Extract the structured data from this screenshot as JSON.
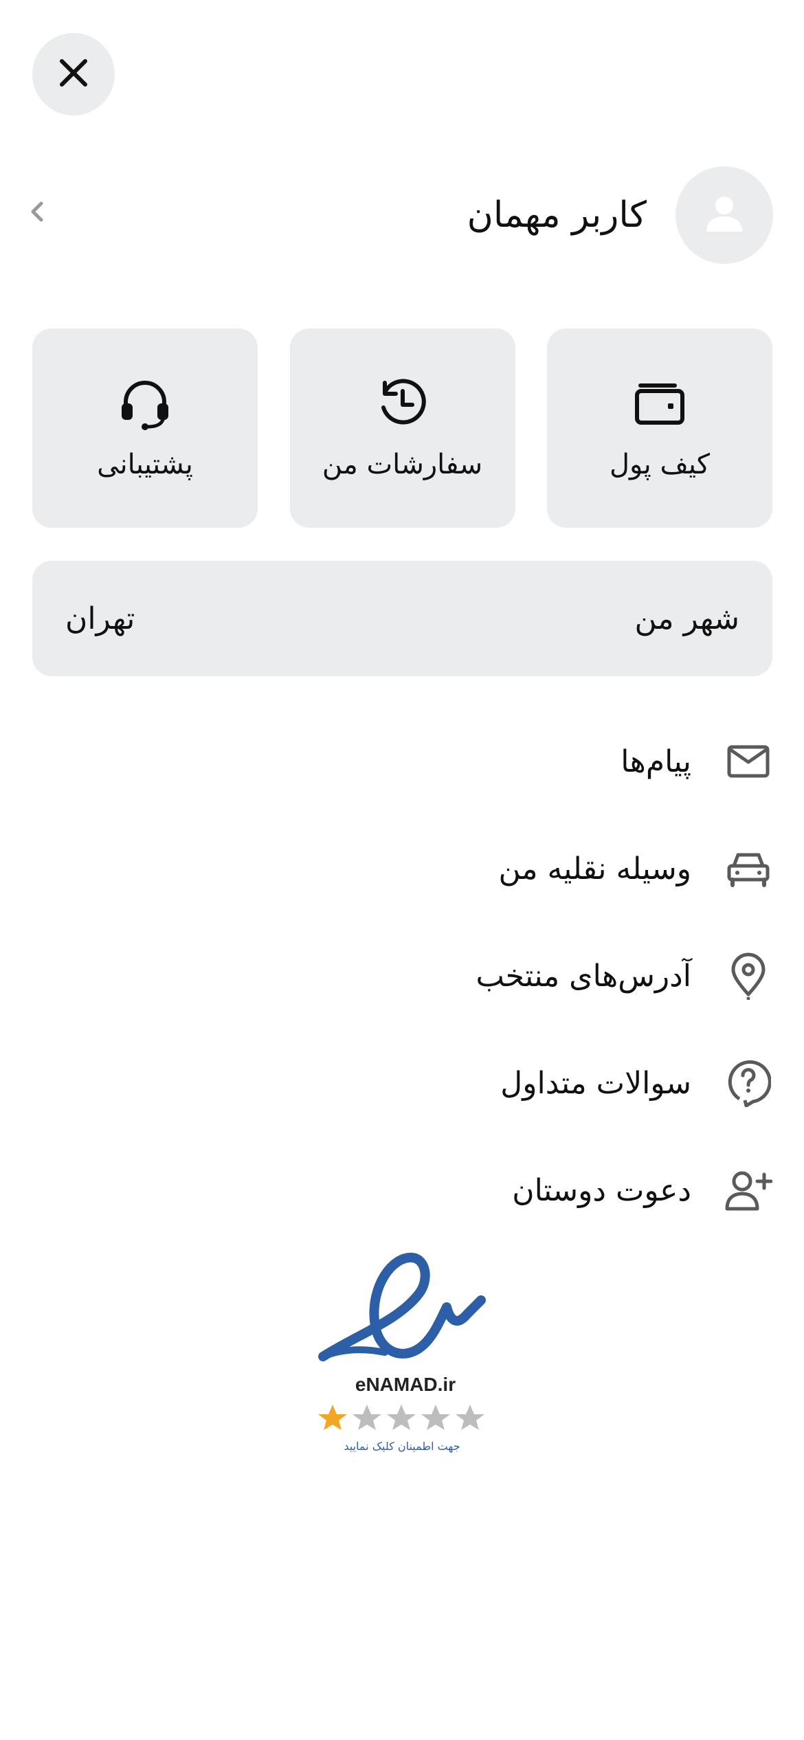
{
  "header": {
    "close_icon": "close-icon"
  },
  "profile": {
    "name": "کاربر مهمان",
    "avatar_icon": "user-icon",
    "chevron_icon": "chevron-left-icon"
  },
  "cards": [
    {
      "label": "کیف پول",
      "icon": "wallet-icon"
    },
    {
      "label": "سفارشات من",
      "icon": "history-icon"
    },
    {
      "label": "پشتیبانی",
      "icon": "headset-icon"
    }
  ],
  "city": {
    "label": "شهر من",
    "value": "تهران"
  },
  "menu": [
    {
      "label": "پیام‌ها",
      "icon": "mail-icon"
    },
    {
      "label": "وسیله نقلیه من",
      "icon": "car-icon"
    },
    {
      "label": "آدرس‌های منتخب",
      "icon": "location-pin-icon"
    },
    {
      "label": "سوالات متداول",
      "icon": "faq-icon"
    },
    {
      "label": "دعوت دوستان",
      "icon": "add-user-icon"
    }
  ],
  "badge": {
    "brand": "eNAMAD.ir",
    "caption": "جهت اطمینان کلیک نمایید",
    "stars_filled": 1,
    "stars_total": 5
  },
  "colors": {
    "background": "#ffffff",
    "card": "#ebecee",
    "icon_gray": "#5a5a5a",
    "enamad_blue": "#2d5ea8",
    "star_gold": "#f2a623",
    "star_gray": "#bdbdbd"
  }
}
